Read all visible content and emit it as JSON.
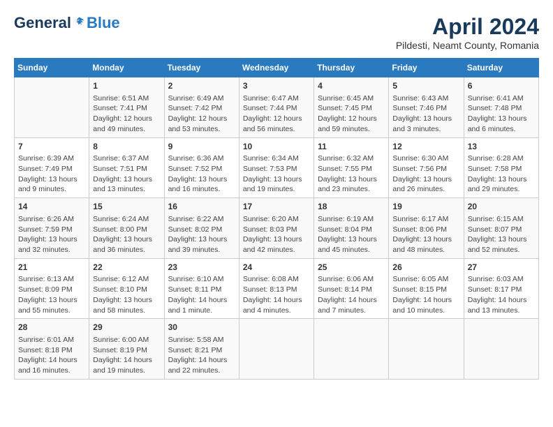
{
  "logo": {
    "general": "General",
    "blue": "Blue"
  },
  "title": "April 2024",
  "subtitle": "Pildesti, Neamt County, Romania",
  "days": [
    "Sunday",
    "Monday",
    "Tuesday",
    "Wednesday",
    "Thursday",
    "Friday",
    "Saturday"
  ],
  "weeks": [
    [
      {
        "day": "",
        "content": ""
      },
      {
        "day": "1",
        "content": "Sunrise: 6:51 AM\nSunset: 7:41 PM\nDaylight: 12 hours\nand 49 minutes."
      },
      {
        "day": "2",
        "content": "Sunrise: 6:49 AM\nSunset: 7:42 PM\nDaylight: 12 hours\nand 53 minutes."
      },
      {
        "day": "3",
        "content": "Sunrise: 6:47 AM\nSunset: 7:44 PM\nDaylight: 12 hours\nand 56 minutes."
      },
      {
        "day": "4",
        "content": "Sunrise: 6:45 AM\nSunset: 7:45 PM\nDaylight: 12 hours\nand 59 minutes."
      },
      {
        "day": "5",
        "content": "Sunrise: 6:43 AM\nSunset: 7:46 PM\nDaylight: 13 hours\nand 3 minutes."
      },
      {
        "day": "6",
        "content": "Sunrise: 6:41 AM\nSunset: 7:48 PM\nDaylight: 13 hours\nand 6 minutes."
      }
    ],
    [
      {
        "day": "7",
        "content": "Sunrise: 6:39 AM\nSunset: 7:49 PM\nDaylight: 13 hours\nand 9 minutes."
      },
      {
        "day": "8",
        "content": "Sunrise: 6:37 AM\nSunset: 7:51 PM\nDaylight: 13 hours\nand 13 minutes."
      },
      {
        "day": "9",
        "content": "Sunrise: 6:36 AM\nSunset: 7:52 PM\nDaylight: 13 hours\nand 16 minutes."
      },
      {
        "day": "10",
        "content": "Sunrise: 6:34 AM\nSunset: 7:53 PM\nDaylight: 13 hours\nand 19 minutes."
      },
      {
        "day": "11",
        "content": "Sunrise: 6:32 AM\nSunset: 7:55 PM\nDaylight: 13 hours\nand 23 minutes."
      },
      {
        "day": "12",
        "content": "Sunrise: 6:30 AM\nSunset: 7:56 PM\nDaylight: 13 hours\nand 26 minutes."
      },
      {
        "day": "13",
        "content": "Sunrise: 6:28 AM\nSunset: 7:58 PM\nDaylight: 13 hours\nand 29 minutes."
      }
    ],
    [
      {
        "day": "14",
        "content": "Sunrise: 6:26 AM\nSunset: 7:59 PM\nDaylight: 13 hours\nand 32 minutes."
      },
      {
        "day": "15",
        "content": "Sunrise: 6:24 AM\nSunset: 8:00 PM\nDaylight: 13 hours\nand 36 minutes."
      },
      {
        "day": "16",
        "content": "Sunrise: 6:22 AM\nSunset: 8:02 PM\nDaylight: 13 hours\nand 39 minutes."
      },
      {
        "day": "17",
        "content": "Sunrise: 6:20 AM\nSunset: 8:03 PM\nDaylight: 13 hours\nand 42 minutes."
      },
      {
        "day": "18",
        "content": "Sunrise: 6:19 AM\nSunset: 8:04 PM\nDaylight: 13 hours\nand 45 minutes."
      },
      {
        "day": "19",
        "content": "Sunrise: 6:17 AM\nSunset: 8:06 PM\nDaylight: 13 hours\nand 48 minutes."
      },
      {
        "day": "20",
        "content": "Sunrise: 6:15 AM\nSunset: 8:07 PM\nDaylight: 13 hours\nand 52 minutes."
      }
    ],
    [
      {
        "day": "21",
        "content": "Sunrise: 6:13 AM\nSunset: 8:09 PM\nDaylight: 13 hours\nand 55 minutes."
      },
      {
        "day": "22",
        "content": "Sunrise: 6:12 AM\nSunset: 8:10 PM\nDaylight: 13 hours\nand 58 minutes."
      },
      {
        "day": "23",
        "content": "Sunrise: 6:10 AM\nSunset: 8:11 PM\nDaylight: 14 hours\nand 1 minute."
      },
      {
        "day": "24",
        "content": "Sunrise: 6:08 AM\nSunset: 8:13 PM\nDaylight: 14 hours\nand 4 minutes."
      },
      {
        "day": "25",
        "content": "Sunrise: 6:06 AM\nSunset: 8:14 PM\nDaylight: 14 hours\nand 7 minutes."
      },
      {
        "day": "26",
        "content": "Sunrise: 6:05 AM\nSunset: 8:15 PM\nDaylight: 14 hours\nand 10 minutes."
      },
      {
        "day": "27",
        "content": "Sunrise: 6:03 AM\nSunset: 8:17 PM\nDaylight: 14 hours\nand 13 minutes."
      }
    ],
    [
      {
        "day": "28",
        "content": "Sunrise: 6:01 AM\nSunset: 8:18 PM\nDaylight: 14 hours\nand 16 minutes."
      },
      {
        "day": "29",
        "content": "Sunrise: 6:00 AM\nSunset: 8:19 PM\nDaylight: 14 hours\nand 19 minutes."
      },
      {
        "day": "30",
        "content": "Sunrise: 5:58 AM\nSunset: 8:21 PM\nDaylight: 14 hours\nand 22 minutes."
      },
      {
        "day": "",
        "content": ""
      },
      {
        "day": "",
        "content": ""
      },
      {
        "day": "",
        "content": ""
      },
      {
        "day": "",
        "content": ""
      }
    ]
  ]
}
